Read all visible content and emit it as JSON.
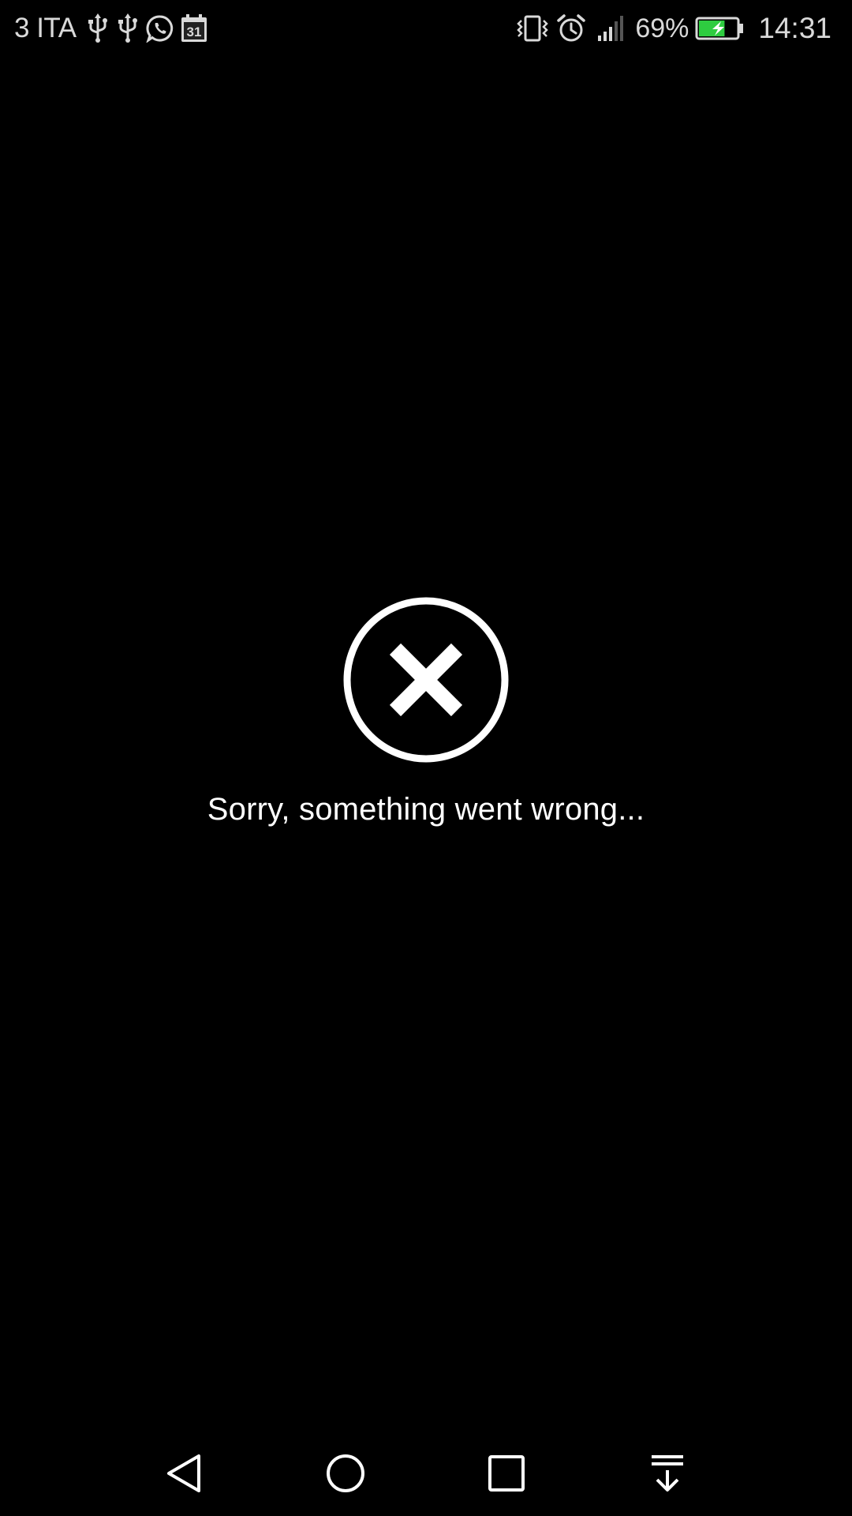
{
  "status_bar": {
    "carrier": "3 ITA",
    "left_icons": [
      "usb-icon",
      "usb-icon",
      "whatsapp-icon",
      "calendar-icon"
    ],
    "calendar_day": "31",
    "right_icons": [
      "vibrate-icon",
      "alarm-icon",
      "signal-icon"
    ],
    "battery_percent": "69%",
    "battery_level": 0.69,
    "battery_color": "#2ecc40",
    "time": "14:31"
  },
  "error": {
    "icon": "error-x-circle-icon",
    "message": "Sorry, something went wrong..."
  },
  "nav_bar": {
    "buttons": [
      "back-icon",
      "home-icon",
      "recents-icon",
      "notification-drawer-icon"
    ]
  }
}
